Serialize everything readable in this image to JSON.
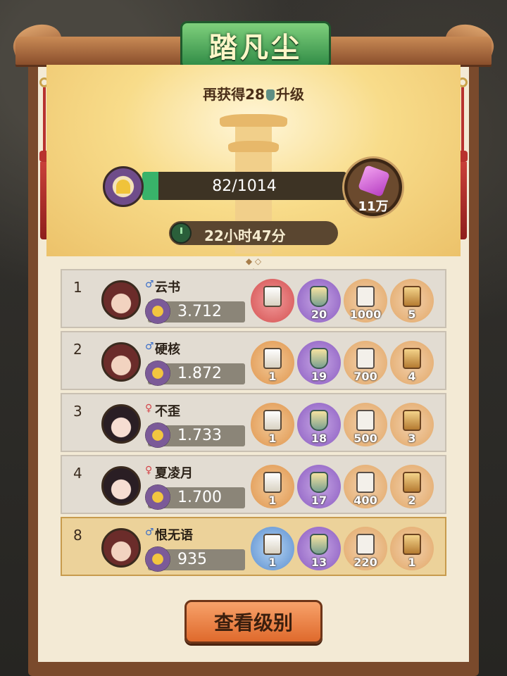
{
  "title": "踏凡尘",
  "subtitle": {
    "prefix": "再获得28",
    "suffix": "升级"
  },
  "progress": {
    "text": "82/1014",
    "current": 82,
    "max": 1014
  },
  "reward": {
    "amount": "11万"
  },
  "timer": {
    "text": "22小时47分"
  },
  "ranking": [
    {
      "rank": "1",
      "gender": "♂",
      "name": "云书",
      "score": "3.712",
      "prizes": [
        "",
        "20",
        "1000",
        "5"
      ]
    },
    {
      "rank": "2",
      "gender": "♂",
      "name": "硬核",
      "score": "1.872",
      "prizes": [
        "1",
        "19",
        "700",
        "4"
      ]
    },
    {
      "rank": "3",
      "gender": "♀",
      "name": "不歪",
      "score": "1.733",
      "prizes": [
        "1",
        "18",
        "500",
        "3"
      ]
    },
    {
      "rank": "4",
      "gender": "♀",
      "name": "夏凌月",
      "score": "1.700",
      "prizes": [
        "1",
        "17",
        "400",
        "2"
      ]
    },
    {
      "rank": "8",
      "gender": "♂",
      "name": "恨无语",
      "score": "935",
      "prizes": [
        "1",
        "13",
        "220",
        "1"
      ]
    }
  ],
  "button": {
    "label": "查看级别"
  }
}
